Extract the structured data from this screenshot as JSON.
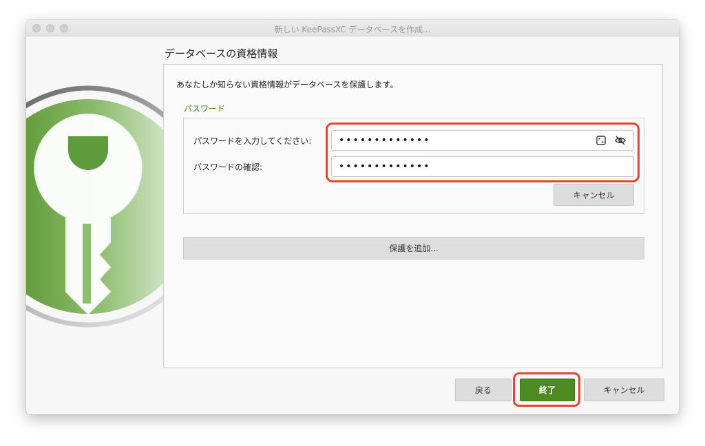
{
  "window": {
    "title": "新しい KeePassXC データベースを作成..."
  },
  "page": {
    "heading": "データベースの資格情報",
    "intro": "あなたしか知らない資格情報がデータベースを保護します。"
  },
  "password_section": {
    "label": "パスワード",
    "enter_label": "パスワードを入力してください:",
    "enter_value": "•••••••••••••",
    "confirm_label": "パスワードの確認:",
    "confirm_value": "•••••••••••••",
    "cancel_label": "キャンセル",
    "icons": [
      "dice-icon",
      "eye-slash-icon"
    ]
  },
  "add_protection_label": "保護を追加...",
  "footer": {
    "back_label": "戻る",
    "finish_label": "終了",
    "cancel_label": "キャンセル"
  },
  "colors": {
    "accent_green": "#4d8a22",
    "highlight_red": "#e3462f"
  }
}
